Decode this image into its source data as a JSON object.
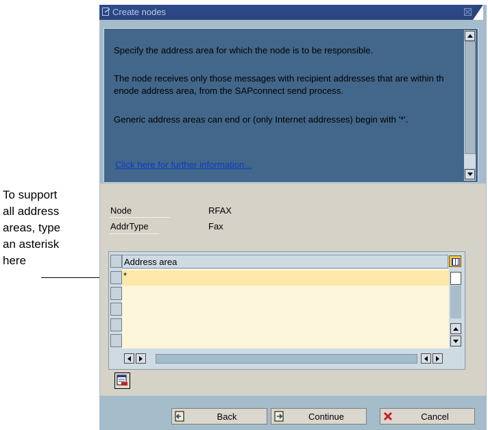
{
  "callout": {
    "lines": [
      "To support",
      "all address",
      "areas, type",
      "an asterisk",
      "here"
    ]
  },
  "window": {
    "title": "Create nodes"
  },
  "info": {
    "paragraph1": "Specify the address area for which the node is to be responsible.",
    "paragraph2": "The node receives only those messages with recipient addresses that are within th enode address area, from the SAPconnect send process.",
    "paragraph3": "Generic address areas can end or (only Internet addresses) begin with '*'.",
    "link": "Click here for further information..."
  },
  "fields": [
    {
      "label": "Node",
      "value": "RFAX"
    },
    {
      "label": "AddrType",
      "value": "Fax"
    }
  ],
  "table": {
    "column_header": "Address area",
    "rows": [
      "*",
      "",
      "",
      "",
      ""
    ]
  },
  "buttons": {
    "back": "Back",
    "continue": "Continue",
    "cancel": "Cancel"
  },
  "colors": {
    "titlebar": "#2a447f",
    "info_bg": "#42678a",
    "dialog_gray": "#d5d2c8",
    "selected_row": "#fde7a9",
    "link": "#0a3cc9"
  },
  "icons": {
    "title": "dialog-icon",
    "table_settings": "table-settings-icon",
    "delete_row": "delete-row-icon",
    "back": "back-icon",
    "continue": "continue-icon",
    "cancel": "cancel-x-icon"
  }
}
